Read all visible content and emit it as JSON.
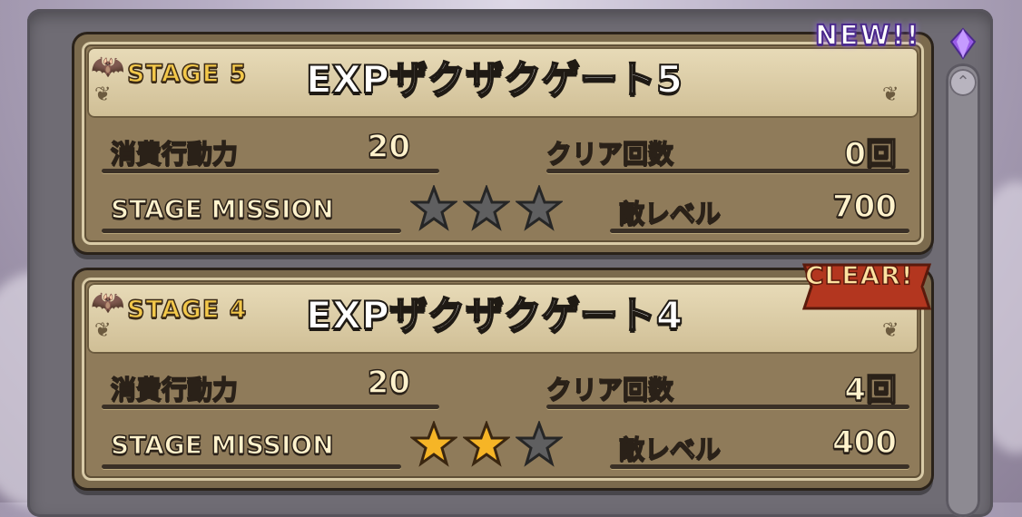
{
  "badges": {
    "new": "NEW!!",
    "clear": "CLEAR!"
  },
  "labels": {
    "cost": "消費行動力",
    "clears": "クリア回数",
    "mission": "STAGE MISSION",
    "enemy_level": "敵レベル"
  },
  "stages": [
    {
      "stage_label": "STAGE 5",
      "title": "EXPザクザクゲート5",
      "cost": "20",
      "clears": "0回",
      "enemy_level": "700",
      "stars_earned": 0,
      "stars_total": 3,
      "badge": "new"
    },
    {
      "stage_label": "STAGE 4",
      "title": "EXPザクザクゲート4",
      "cost": "20",
      "clears": "4回",
      "enemy_level": "400",
      "stars_earned": 2,
      "stars_total": 3,
      "badge": "clear"
    }
  ],
  "colors": {
    "star_gold": "#f6b526",
    "star_gray": "#5f5f60",
    "card_frame": "#2a221a",
    "label_text": "#fff2cc"
  },
  "icons": {
    "gem": "purple-gem-icon",
    "scroll_up": "scroll-up-icon",
    "bat": "bat-icon",
    "ornament": "ornament-icon"
  }
}
